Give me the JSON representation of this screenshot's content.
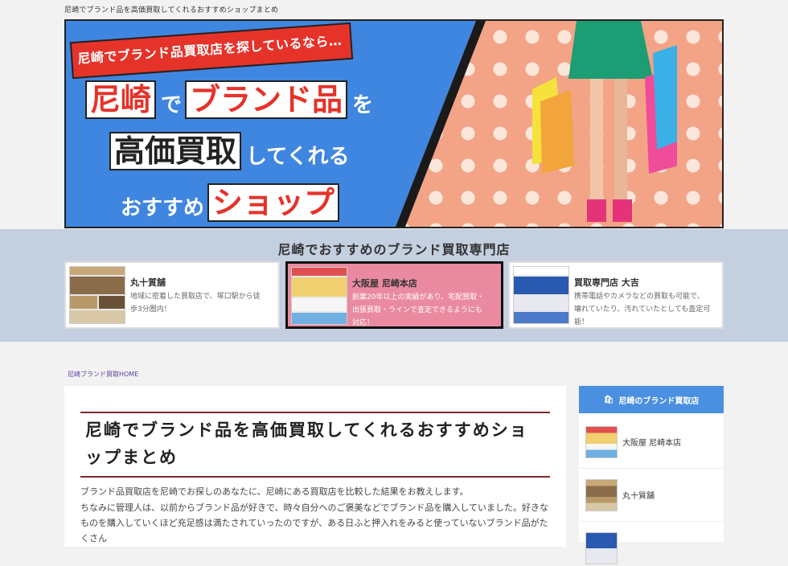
{
  "site_title": "尼崎でブランド品を高価買取してくれるおすすめショップまとめ",
  "banner": {
    "tag": "尼崎でブランド品買取店を探しているなら…",
    "line1": [
      {
        "text": "尼崎",
        "style": "box"
      },
      {
        "text": "で",
        "style": "small"
      },
      {
        "text": "ブランド品",
        "style": "box"
      },
      {
        "text": "を",
        "style": "small"
      }
    ],
    "line2": [
      {
        "text": "高価買取",
        "style": "box-dark"
      },
      {
        "text": "してくれる",
        "style": "small"
      }
    ],
    "line3": [
      {
        "text": "おすすめ",
        "style": "small"
      },
      {
        "text": "ショップ",
        "style": "box"
      }
    ],
    "colors": {
      "blue": "#3f86e0",
      "red": "#e5332a",
      "dots": "#f3a386"
    }
  },
  "featured": {
    "title": "尼崎でおすすめのブランド買取専門店",
    "cards": [
      {
        "name": "丸十質舗",
        "desc": "地域に密着した買取店で、塚口駅から徒歩3分圏内！"
      },
      {
        "name": "大阪屋 尼崎本店",
        "desc": "創業20年以上の実績があり、宅配買取・出張買取・ラインで査定できるようにも対応！"
      },
      {
        "name": "買取専門店 大吉",
        "desc": "携帯電話やカメラなどの買取も可能で、壊れていたり、汚れていたとしても査定可能！"
      }
    ]
  },
  "breadcrumb": "尼崎ブランド買取HOME",
  "article": {
    "title": "尼崎でブランド品を高価買取してくれるおすすめショップまとめ",
    "p1": "ブランド品買取店を尼崎でお探しのあなたに、尼崎にある買取店を比較した結果をお教えします。",
    "p2": "ちなみに管理人は、以前からブランド品が好きで、時々自分へのご褒美などでブランド品を購入していました。好きなものを購入していくほど充足感は満たされていったのですが、ある日ふと押入れをみると使っていないブランド品がたくさん"
  },
  "sidebar": {
    "heading": "尼崎のブランド買取店",
    "items": [
      "大阪屋 尼崎本店",
      "丸十質舗"
    ]
  }
}
